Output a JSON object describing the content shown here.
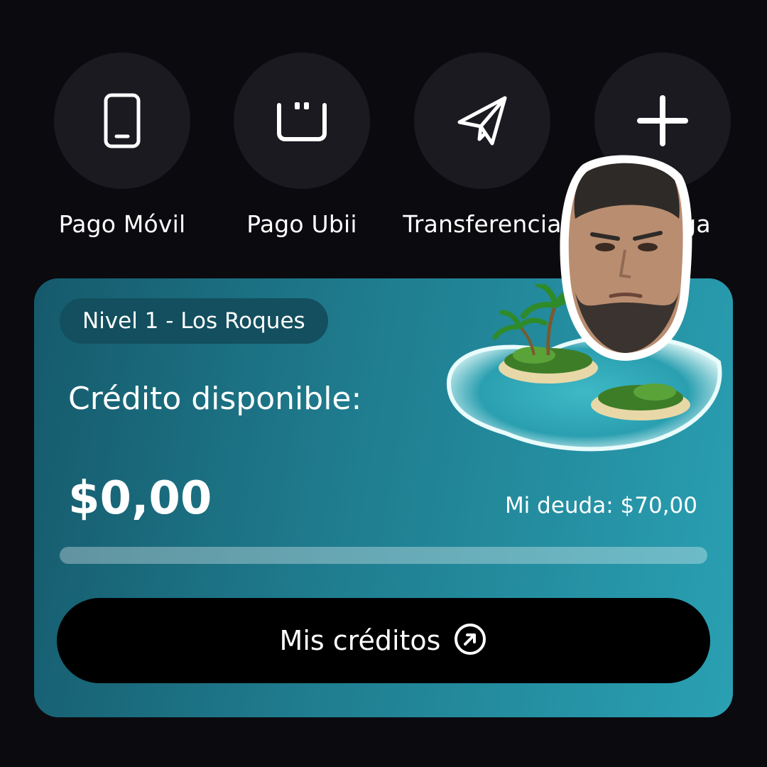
{
  "actions": [
    {
      "label": "Pago Móvil",
      "icon": "smartphone-icon"
    },
    {
      "label": "Pago Ubii",
      "icon": "ubii-logo-icon"
    },
    {
      "label": "Transferencia",
      "icon": "paper-plane-icon"
    },
    {
      "label": "Recarga",
      "icon": "plus-icon"
    }
  ],
  "card": {
    "level_badge": "Nivel 1 - Los Roques",
    "credit_label": "Crédito disponible:",
    "credit_amount": "$0,00",
    "debt_label": "Mi deuda: $70,00",
    "progress_fraction": 0,
    "cta_label": "Mis créditos",
    "cta_icon": "arrow-up-right-circle-icon",
    "gradient_start": "#155a6c",
    "gradient_end": "#2aa0b3"
  },
  "colors": {
    "background": "#0b0a0f",
    "action_circle": "#1b1a21",
    "cta_background": "#000000"
  }
}
